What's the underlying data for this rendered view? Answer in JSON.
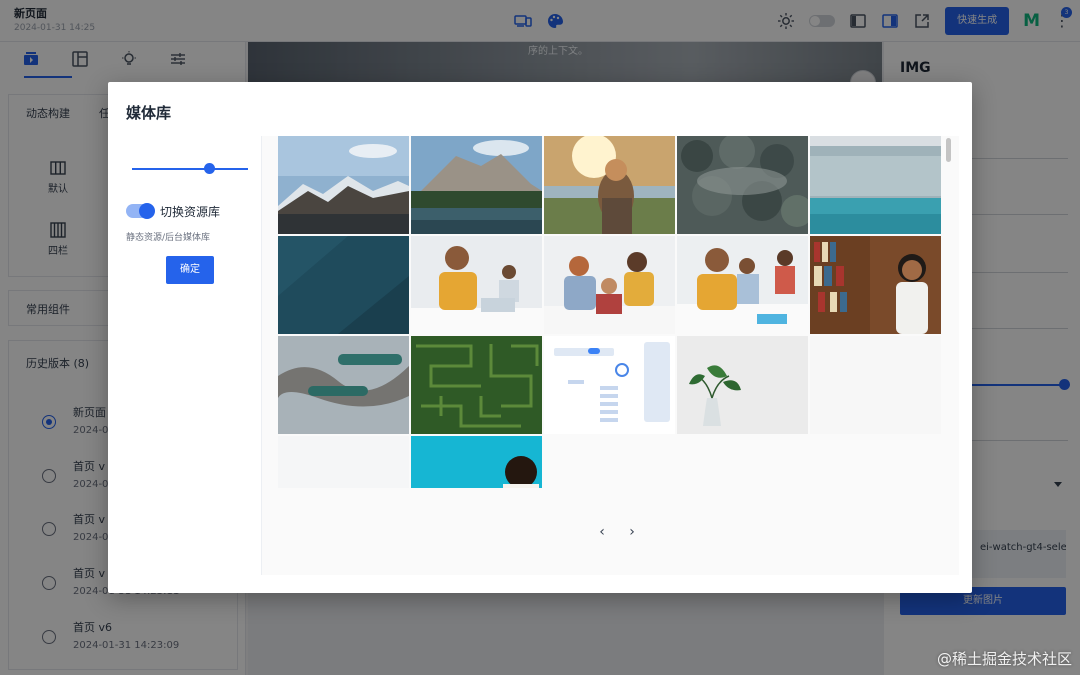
{
  "topbar": {
    "title": "新页面",
    "date": "2024-01-31 14:25",
    "quick_generate": "快速生成",
    "logo": "M",
    "notification_count": "3",
    "more": "⋮"
  },
  "left_panel": {
    "section_dynamic": "动态构建",
    "section_cut": "任",
    "layouts": [
      {
        "label": "默认"
      },
      {
        "label": "四栏"
      }
    ],
    "common_components": "常用组件",
    "history_title": "历史版本 (8)",
    "history": [
      {
        "name": "新页面",
        "time": "2024-0"
      },
      {
        "name": "首页 v",
        "time": "2024-0"
      },
      {
        "name": "首页 v",
        "time": "2024-0"
      },
      {
        "name": "首页 v",
        "time": "2024-01-31 14:23:11"
      },
      {
        "name": "首页 v6",
        "time": "2024-01-31 14:23:09"
      }
    ]
  },
  "canvas": {
    "caption": "序的上下文。"
  },
  "right_panel": {
    "title": "IMG",
    "file_name": "ei-watch-gt4-selec",
    "update_button": "更新图片"
  },
  "modal": {
    "title": "媒体库",
    "slider_value": 0.68,
    "switch_label": "切换资源库",
    "hint": "静态资源/后台媒体库",
    "confirm": "确定",
    "thumbnails": [
      {
        "name": "thumb-mountain-lake"
      },
      {
        "name": "thumb-rock-peak-lake"
      },
      {
        "name": "thumb-woman-sunset"
      },
      {
        "name": "thumb-foggy-forest"
      },
      {
        "name": "thumb-snowy-forest-lake"
      },
      {
        "name": "thumb-dark-teal"
      },
      {
        "name": "thumb-students-1"
      },
      {
        "name": "thumb-students-2"
      },
      {
        "name": "thumb-students-3"
      },
      {
        "name": "thumb-library-woman"
      },
      {
        "name": "thumb-ships-aerial"
      },
      {
        "name": "thumb-green-maze"
      },
      {
        "name": "thumb-ui-dashboard"
      },
      {
        "name": "thumb-plant-vase"
      },
      {
        "name": "thumb-blank"
      },
      {
        "name": "thumb-blank-2"
      },
      {
        "name": "thumb-cyan-person"
      }
    ],
    "pager_prev": "‹",
    "pager_next": "›"
  },
  "watermark": "@稀土掘金技术社区",
  "colors": {
    "primary": "#2563eb",
    "logo_green": "#10b981"
  }
}
